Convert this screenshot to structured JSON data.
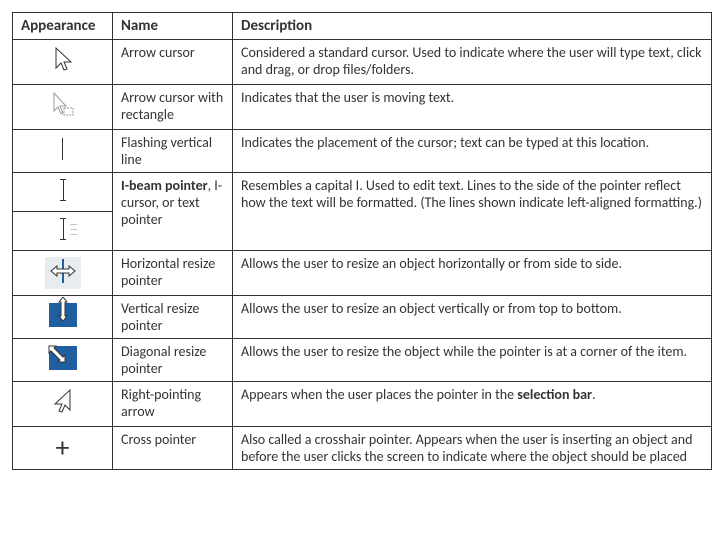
{
  "headers": {
    "c1": "Appearance",
    "c2": "Name",
    "c3": "Description"
  },
  "rows": [
    {
      "name": "Arrow cursor",
      "desc": "Considered a standard cursor. Used to indicate where the user will type text, click and drag, or drop files/folders."
    },
    {
      "name": "Arrow cursor with rectangle",
      "desc": "Indicates that the user is moving text."
    },
    {
      "name": "Flashing vertical line",
      "desc": "Indicates the placement of the cursor; text can be typed at this location."
    },
    {
      "name_b": "I-beam pointer",
      "name_rest": ", I-cursor, or text pointer",
      "desc_pre": "Resembles a capital I. Used to edit text. Lines to the side of the pointer reflect how the text will be formatted. (The lines shown indicate left-aligned formatting.)"
    },
    {
      "name": "Horizontal resize pointer",
      "desc": "Allows the user to resize an object horizontally or from side to side."
    },
    {
      "name": "Vertical resize pointer",
      "desc": "Allows the user to resize an object vertically or from top to bottom."
    },
    {
      "name": "Diagonal resize pointer",
      "desc": "Allows the user to resize the object while the pointer is at a corner of the item."
    },
    {
      "name": "Right-pointing arrow",
      "desc_pre": "Appears when the user places the pointer in the ",
      "desc_b": "selection bar",
      "desc_post": "."
    },
    {
      "name": "Cross pointer",
      "desc": "Also called a crosshair pointer. Appears when the user is inserting an object and before the user clicks the screen to indicate where the object should be placed"
    }
  ]
}
